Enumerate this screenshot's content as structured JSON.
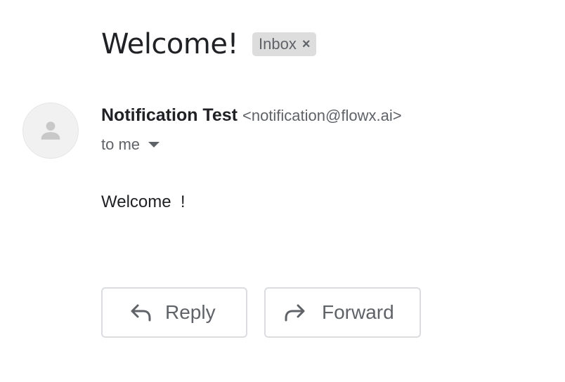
{
  "email": {
    "subject": "Welcome!",
    "label": {
      "text": "Inbox",
      "close_glyph": "×"
    },
    "sender": {
      "name": "Notification Test",
      "email": "<notification@flowx.ai>",
      "avatar_icon": "person-icon"
    },
    "recipient": {
      "text": "to me",
      "toggle_icon": "caret-down-icon"
    },
    "body": "Welcome  !"
  },
  "actions": {
    "reply_label": "Reply",
    "reply_icon": "reply-arrow-icon",
    "forward_label": "Forward",
    "forward_icon": "forward-arrow-icon"
  },
  "colors": {
    "text_primary": "#202124",
    "text_secondary": "#5f6368",
    "chip_background": "#dddddd",
    "button_border": "#dadce0",
    "avatar_background": "#f1f1f1",
    "avatar_glyph": "#c8c8c8"
  }
}
